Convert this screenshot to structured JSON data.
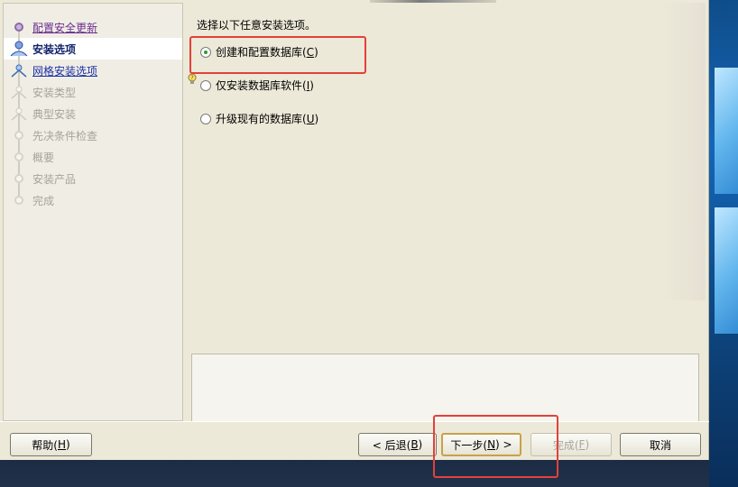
{
  "steps": [
    {
      "label": "配置安全更新",
      "state": "done"
    },
    {
      "label": "安装选项",
      "state": "active"
    },
    {
      "label": "网格安装选项",
      "state": "link"
    },
    {
      "label": "安装类型",
      "state": "future"
    },
    {
      "label": "典型安装",
      "state": "future"
    },
    {
      "label": "先决条件检查",
      "state": "future"
    },
    {
      "label": "概要",
      "state": "future"
    },
    {
      "label": "安装产品",
      "state": "future"
    },
    {
      "label": "完成",
      "state": "future"
    }
  ],
  "main": {
    "prompt": "选择以下任意安装选项。",
    "options": [
      {
        "label": "创建和配置数据库(",
        "key": "C",
        "suffix": ")",
        "selected": true
      },
      {
        "label": "仅安装数据库软件(",
        "key": "I",
        "suffix": ")",
        "selected": false
      },
      {
        "label": "升级现有的数据库(",
        "key": "U",
        "suffix": ")",
        "selected": false
      }
    ]
  },
  "buttons": {
    "help": {
      "label": "帮助(",
      "key": "H",
      "suffix": ")"
    },
    "back": {
      "label": "< 后退(",
      "key": "B",
      "suffix": ")"
    },
    "next": {
      "label": "下一步(",
      "key": "N",
      "suffix": ") >"
    },
    "finish": {
      "label": "完成(",
      "key": "F",
      "suffix": ")"
    },
    "cancel": {
      "label": "取消"
    }
  },
  "colors": {
    "annotation": "#e2413b",
    "selected_radio": "#2e9b2e"
  }
}
